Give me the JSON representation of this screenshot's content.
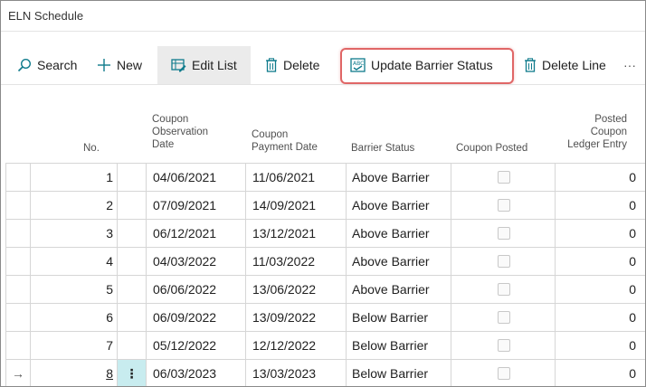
{
  "window": {
    "title": "ELN Schedule"
  },
  "actions": {
    "search": "Search",
    "new": "New",
    "edit_list": "Edit List",
    "delete": "Delete",
    "update_barrier_status": "Update Barrier Status",
    "delete_line": "Delete Line",
    "more": "···"
  },
  "columns": {
    "no": "No.",
    "coupon_observation_date": [
      "Coupon",
      "Observation",
      "Date"
    ],
    "coupon_payment_date": [
      "Coupon",
      "Payment Date"
    ],
    "barrier_status": "Barrier Status",
    "coupon_posted": "Coupon Posted",
    "posted_coupon_ledger_entry": [
      "Posted",
      "Coupon",
      "Ledger Entry"
    ]
  },
  "rows": [
    {
      "no": "1",
      "obs": "04/06/2021",
      "pay": "11/06/2021",
      "status": "Above Barrier",
      "posted": false,
      "ledger": "0"
    },
    {
      "no": "2",
      "obs": "07/09/2021",
      "pay": "14/09/2021",
      "status": "Above Barrier",
      "posted": false,
      "ledger": "0"
    },
    {
      "no": "3",
      "obs": "06/12/2021",
      "pay": "13/12/2021",
      "status": "Above Barrier",
      "posted": false,
      "ledger": "0"
    },
    {
      "no": "4",
      "obs": "04/03/2022",
      "pay": "11/03/2022",
      "status": "Above Barrier",
      "posted": false,
      "ledger": "0"
    },
    {
      "no": "5",
      "obs": "06/06/2022",
      "pay": "13/06/2022",
      "status": "Above Barrier",
      "posted": false,
      "ledger": "0"
    },
    {
      "no": "6",
      "obs": "06/09/2022",
      "pay": "13/09/2022",
      "status": "Below Barrier",
      "posted": false,
      "ledger": "0"
    },
    {
      "no": "7",
      "obs": "05/12/2022",
      "pay": "12/12/2022",
      "status": "Below Barrier",
      "posted": false,
      "ledger": "0"
    },
    {
      "no": "8",
      "obs": "06/03/2023",
      "pay": "13/03/2023",
      "status": "Below Barrier",
      "posted": false,
      "ledger": "0",
      "selected": true
    }
  ],
  "row_indicator": "→",
  "row_menu": "⋮",
  "colors": {
    "accent": "#0f7b8c",
    "highlight_border": "#e06666",
    "selected_cell": "#c8ecef"
  }
}
